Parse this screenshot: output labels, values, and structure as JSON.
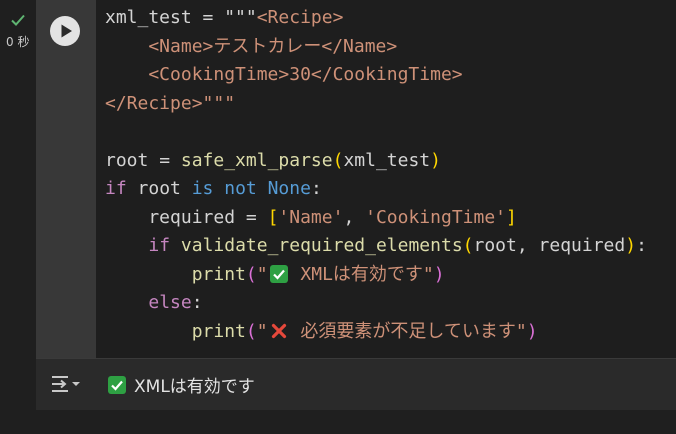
{
  "execution": {
    "time": "0 秒",
    "status_icon": "check-icon"
  },
  "cell": {
    "run_icon": "play-icon",
    "code": {
      "l1_a": "xml_test = \"\"\"",
      "l1_b": "<Recipe>",
      "l2": "    <Name>テストカレー</Name>",
      "l3": "    <CookingTime>30</CookingTime>",
      "l4": "</Recipe>\"\"\"",
      "l6_a": "root",
      "l6_b": " = ",
      "l6_c": "safe_xml_parse",
      "l6_d": "(",
      "l6_e": "xml_test",
      "l6_f": ")",
      "l7_a": "if",
      "l7_b": " root ",
      "l7_c": "is not",
      "l7_d": " ",
      "l7_e": "None",
      "l7_f": ":",
      "l8_a": "    required = ",
      "l8_b": "[",
      "l8_c": "'Name'",
      "l8_d": ", ",
      "l8_e": "'CookingTime'",
      "l8_f": "]",
      "l9_a": "    ",
      "l9_b": "if",
      "l9_c": " ",
      "l9_d": "validate_required_elements",
      "l9_e": "(",
      "l9_f": "root, required",
      "l9_g": ")",
      "l9_h": ":",
      "l10_a": "        ",
      "l10_b": "print",
      "l10_c": "(",
      "l10_d": "\"",
      "l10_e": " XMLは有効です\"",
      "l10_f": ")",
      "l11_a": "    ",
      "l11_b": "else",
      "l11_c": ":",
      "l12_a": "        ",
      "l12_b": "print",
      "l12_c": "(",
      "l12_d": "\"",
      "l12_e": " 必須要素が不足しています\"",
      "l12_f": ")"
    }
  },
  "output": {
    "icon": "output-toggle-icon",
    "text": "XMLは有効です"
  },
  "colors": {
    "background": "#1f1f1f",
    "editor": "#1e1e1e",
    "string": "#ce9178",
    "keyword": "#c586c0",
    "builtin": "#569cd6",
    "function": "#dcdcaa",
    "brace": "#ffd700",
    "bracket": "#da70d6",
    "check_green": "#2ea043"
  }
}
